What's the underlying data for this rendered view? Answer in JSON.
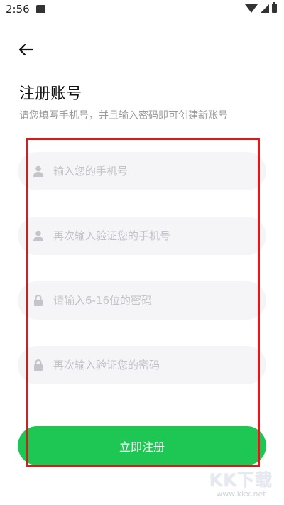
{
  "status_bar": {
    "time": "2:56"
  },
  "header": {
    "title": "注册账号",
    "subtitle": "请您填写手机号，并且输入密码即可创建新账号"
  },
  "form": {
    "phone_placeholder": "输入您的手机号",
    "phone_confirm_placeholder": "再次输入验证您的手机号",
    "password_placeholder": "请输入6-16位的密码",
    "password_confirm_placeholder": "再次输入验证您的密码",
    "submit_label": "立即注册"
  },
  "watermark": {
    "brand": "KK下载",
    "url": "www.kkx.net"
  },
  "colors": {
    "accent": "#1ec654",
    "highlight": "#d81c1c",
    "field_bg": "#f5f5f8"
  }
}
